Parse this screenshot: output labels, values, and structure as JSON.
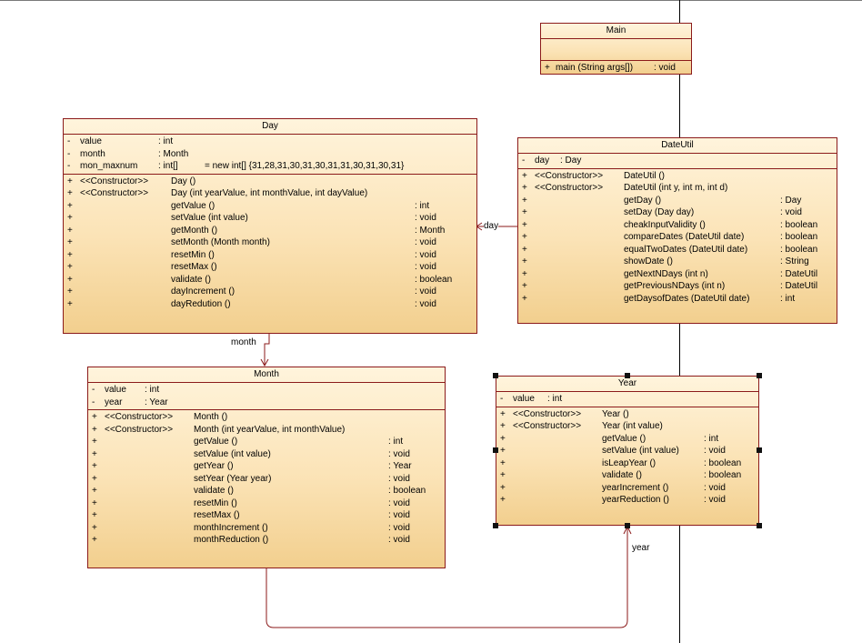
{
  "classes": {
    "main": {
      "name": "Main",
      "attributes": [],
      "operations": [
        {
          "vis": "+",
          "stereo": "",
          "name": "main (String args[])",
          "type": ": void"
        }
      ]
    },
    "day": {
      "name": "Day",
      "attributes": [
        {
          "vis": "-",
          "name": "value",
          "type": ": int",
          "init": ""
        },
        {
          "vis": "-",
          "name": "month",
          "type": ": Month",
          "init": ""
        },
        {
          "vis": "-",
          "name": "mon_maxnum",
          "type": ": int[]",
          "init": "= new int[] {31,28,31,30,31,30,31,31,30,31,30,31}"
        }
      ],
      "operations": [
        {
          "vis": "+",
          "stereo": "<<Constructor>>",
          "name": "Day ()",
          "type": ""
        },
        {
          "vis": "+",
          "stereo": "<<Constructor>>",
          "name": "Day (int yearValue, int monthValue, int dayValue)",
          "type": ""
        },
        {
          "vis": "+",
          "stereo": "",
          "name": "getValue ()",
          "type": ": int"
        },
        {
          "vis": "+",
          "stereo": "",
          "name": "setValue (int value)",
          "type": ": void"
        },
        {
          "vis": "+",
          "stereo": "",
          "name": "getMonth ()",
          "type": ": Month"
        },
        {
          "vis": "+",
          "stereo": "",
          "name": "setMonth (Month month)",
          "type": ": void"
        },
        {
          "vis": "+",
          "stereo": "",
          "name": "resetMin ()",
          "type": ": void"
        },
        {
          "vis": "+",
          "stereo": "",
          "name": "resetMax ()",
          "type": ": void"
        },
        {
          "vis": "+",
          "stereo": "",
          "name": "validate ()",
          "type": ": boolean"
        },
        {
          "vis": "+",
          "stereo": "",
          "name": "dayIncrement ()",
          "type": ": void"
        },
        {
          "vis": "+",
          "stereo": "",
          "name": "dayRedution ()",
          "type": ": void"
        }
      ]
    },
    "dateutil": {
      "name": "DateUtil",
      "attributes": [
        {
          "vis": "-",
          "name": "day",
          "type": ": Day",
          "init": ""
        }
      ],
      "operations": [
        {
          "vis": "+",
          "stereo": "<<Constructor>>",
          "name": "DateUtil ()",
          "type": ""
        },
        {
          "vis": "+",
          "stereo": "<<Constructor>>",
          "name": "DateUtil (int y, int m, int d)",
          "type": ""
        },
        {
          "vis": "+",
          "stereo": "",
          "name": "getDay ()",
          "type": ": Day"
        },
        {
          "vis": "+",
          "stereo": "",
          "name": "setDay (Day day)",
          "type": ": void"
        },
        {
          "vis": "+",
          "stereo": "",
          "name": "cheakInputValidity ()",
          "type": ": boolean"
        },
        {
          "vis": "+",
          "stereo": "",
          "name": "compareDates (DateUtil date)",
          "type": ": boolean"
        },
        {
          "vis": "+",
          "stereo": "",
          "name": "equalTwoDates (DateUtil date)",
          "type": ": boolean"
        },
        {
          "vis": "+",
          "stereo": "",
          "name": "showDate ()",
          "type": ": String"
        },
        {
          "vis": "+",
          "stereo": "",
          "name": "getNextNDays (int n)",
          "type": ": DateUtil"
        },
        {
          "vis": "+",
          "stereo": "",
          "name": "getPreviousNDays (int n)",
          "type": ": DateUtil"
        },
        {
          "vis": "+",
          "stereo": "",
          "name": "getDaysofDates (DateUtil date)",
          "type": ": int"
        }
      ]
    },
    "month": {
      "name": "Month",
      "attributes": [
        {
          "vis": "-",
          "name": "value",
          "type": ": int",
          "init": ""
        },
        {
          "vis": "-",
          "name": "year",
          "type": ": Year",
          "init": ""
        }
      ],
      "operations": [
        {
          "vis": "+",
          "stereo": "<<Constructor>>",
          "name": "Month ()",
          "type": ""
        },
        {
          "vis": "+",
          "stereo": "<<Constructor>>",
          "name": "Month (int yearValue, int monthValue)",
          "type": ""
        },
        {
          "vis": "+",
          "stereo": "",
          "name": "getValue ()",
          "type": ": int"
        },
        {
          "vis": "+",
          "stereo": "",
          "name": "setValue (int value)",
          "type": ": void"
        },
        {
          "vis": "+",
          "stereo": "",
          "name": "getYear ()",
          "type": ": Year"
        },
        {
          "vis": "+",
          "stereo": "",
          "name": "setYear (Year year)",
          "type": ": void"
        },
        {
          "vis": "+",
          "stereo": "",
          "name": "validate ()",
          "type": ": boolean"
        },
        {
          "vis": "+",
          "stereo": "",
          "name": "resetMin ()",
          "type": ": void"
        },
        {
          "vis": "+",
          "stereo": "",
          "name": "resetMax ()",
          "type": ": void"
        },
        {
          "vis": "+",
          "stereo": "",
          "name": "monthIncrement ()",
          "type": ": void"
        },
        {
          "vis": "+",
          "stereo": "",
          "name": "monthReduction ()",
          "type": ": void"
        }
      ]
    },
    "year": {
      "name": "Year",
      "attributes": [
        {
          "vis": "-",
          "name": "value",
          "type": ": int",
          "init": ""
        }
      ],
      "operations": [
        {
          "vis": "+",
          "stereo": "<<Constructor>>",
          "name": "Year ()",
          "type": ""
        },
        {
          "vis": "+",
          "stereo": "<<Constructor>>",
          "name": "Year (int value)",
          "type": ""
        },
        {
          "vis": "+",
          "stereo": "",
          "name": "getValue ()",
          "type": ": int"
        },
        {
          "vis": "+",
          "stereo": "",
          "name": "setValue (int value)",
          "type": ": void"
        },
        {
          "vis": "+",
          "stereo": "",
          "name": "isLeapYear ()",
          "type": ": boolean"
        },
        {
          "vis": "+",
          "stereo": "",
          "name": "validate ()",
          "type": ": boolean"
        },
        {
          "vis": "+",
          "stereo": "",
          "name": "yearIncrement ()",
          "type": ": void"
        },
        {
          "vis": "+",
          "stereo": "",
          "name": "yearReduction ()",
          "type": ": void"
        }
      ]
    }
  },
  "associations": {
    "day_label": "day",
    "month_label": "month",
    "year_label": "year"
  },
  "colors": {
    "border": "#8b1a1a",
    "fill_top": "#fff4dc",
    "fill_bottom": "#f2cf8e",
    "connector": "#8b1a1a"
  }
}
